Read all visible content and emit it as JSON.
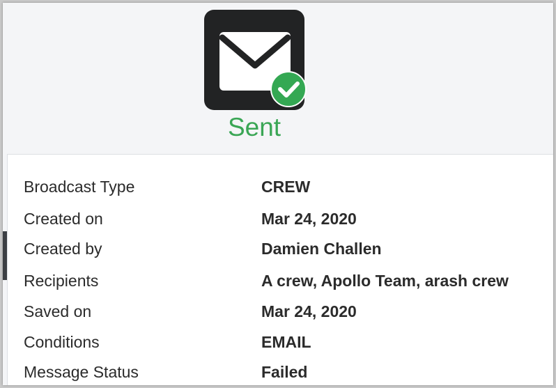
{
  "status": {
    "icon": "envelope-icon",
    "badge_icon": "check-circle-icon",
    "label": "Sent",
    "label_color": "#3aa655",
    "badge_color": "#34a853"
  },
  "details": [
    {
      "label": "Broadcast Type",
      "value": "CREW"
    },
    {
      "label": "Created on",
      "value": "Mar 24, 2020"
    },
    {
      "label": "Created by",
      "value": "Damien Challen"
    },
    {
      "label": "Recipients",
      "value": "A crew, Apollo Team, arash crew"
    },
    {
      "label": "Saved on",
      "value": "Mar 24, 2020"
    },
    {
      "label": "Conditions",
      "value": "EMAIL"
    },
    {
      "label": "Message Status",
      "value": "Failed"
    }
  ]
}
